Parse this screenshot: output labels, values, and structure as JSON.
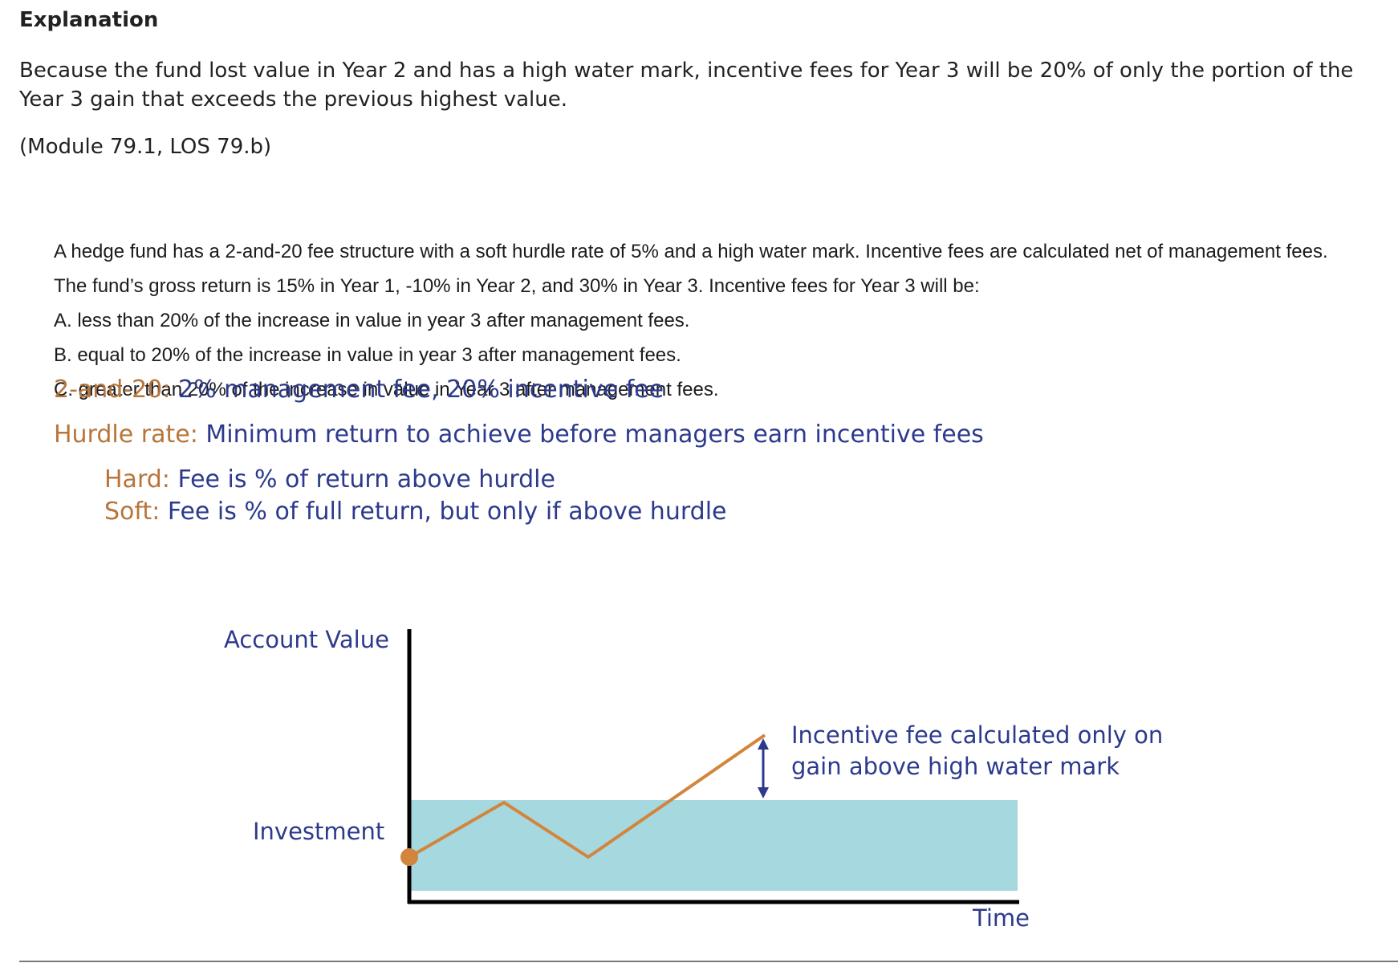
{
  "explanation": {
    "heading": "Explanation",
    "text": "Because the fund lost value in Year 2 and has a high water mark, incentive fees for Year 3 will be 20% of only the portion of the Year 3 gain that exceeds the previous highest value.",
    "module_ref": "(Module 79.1, LOS 79.b)"
  },
  "question": {
    "stem_line1": "A hedge fund has a 2-and-20 fee structure with a soft hurdle rate of 5% and a high water mark. Incentive fees are calculated net of management fees.",
    "stem_line2": "The fund’s gross return is 15% in Year 1, -10% in Year 2, and 30% in Year 3. Incentive fees for Year 3 will be:",
    "options": [
      "A. less than 20% of the increase in value in year 3 after management fees.",
      "B. equal to 20% of the increase in value in year 3 after management fees.",
      "C. greater than 20% of the increase in value in Year 3 after management fees."
    ]
  },
  "definitions": {
    "two_and_twenty": {
      "term": "2-and-20:",
      "desc": "2% management fee, 20% incentive fee"
    },
    "hurdle_rate": {
      "term": "Hurdle rate:",
      "desc": "Minimum return to achieve before managers earn incentive fees"
    },
    "hard": {
      "term": "Hard:",
      "desc": "Fee is % of return above hurdle"
    },
    "soft": {
      "term": "Soft:",
      "desc": "Fee is % of full return, but only if above hurdle"
    }
  },
  "chart": {
    "y_label": "Account Value",
    "x_label": "Time",
    "start_label": "Investment",
    "annotation_line1": "Incentive fee calculated only on",
    "annotation_line2": "gain above high water mark",
    "colors": {
      "line": "#d2853d",
      "area": "#a6d8df",
      "axis": "#000000",
      "text": "#2d3a8c",
      "arrow": "#2d3a8c"
    }
  }
}
